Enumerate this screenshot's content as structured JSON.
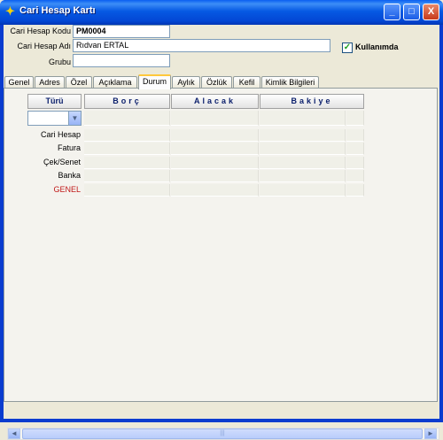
{
  "window": {
    "title": "Cari Hesap Kartı",
    "minimize": "_",
    "maximize": "□",
    "close": "X"
  },
  "form": {
    "kod_label": "Cari Hesap Kodu",
    "kod_value": "PM0004",
    "adi_label": "Cari Hesap Adı",
    "adi_value": "Rıdvan ERTAL",
    "grubu_label": "Grubu",
    "grubu_value": "",
    "kullanimda_label": "Kullanımda",
    "kullanimda_checked": true,
    "check_mark": "✓"
  },
  "tabs": [
    "Genel",
    "Adres",
    "Özel",
    "Açıklama",
    "Durum",
    "Aylık",
    "Özlük",
    "Kefil",
    "Kimlik Bilgileri"
  ],
  "active_tab": "Durum",
  "durum": {
    "turu_header": "Türü",
    "columns": [
      "Borç",
      "Alacak",
      "Bakiye"
    ],
    "turu_value": "",
    "combo_arrow": "▼",
    "rows": [
      "Cari Hesap",
      "Fatura",
      "Çek/Senet",
      "Banka",
      "GENEL"
    ]
  },
  "scrollbar": {
    "left": "◄",
    "right": "►",
    "grip": "|||"
  },
  "colors": {
    "genel_row": "#c01818",
    "header_text": "#0a1e6b",
    "titlebar": "#0659e3"
  },
  "icons": {
    "app": "flame-icon"
  }
}
